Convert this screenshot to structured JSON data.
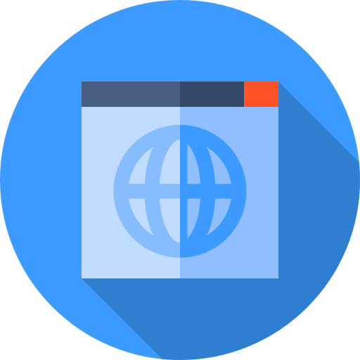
{
  "icon": {
    "name": "web-browser-globe-icon",
    "colors": {
      "circle": "#3d9aff",
      "long_shadow": "#2f7ecf",
      "titlebar_left": "#475f80",
      "titlebar_right": "#344966",
      "close_button": "#ff5327",
      "window_left": "#bfdcff",
      "window_right": "#8fbfff",
      "globe_left": "#87bcff",
      "globe_right": "#3d9aff"
    }
  }
}
